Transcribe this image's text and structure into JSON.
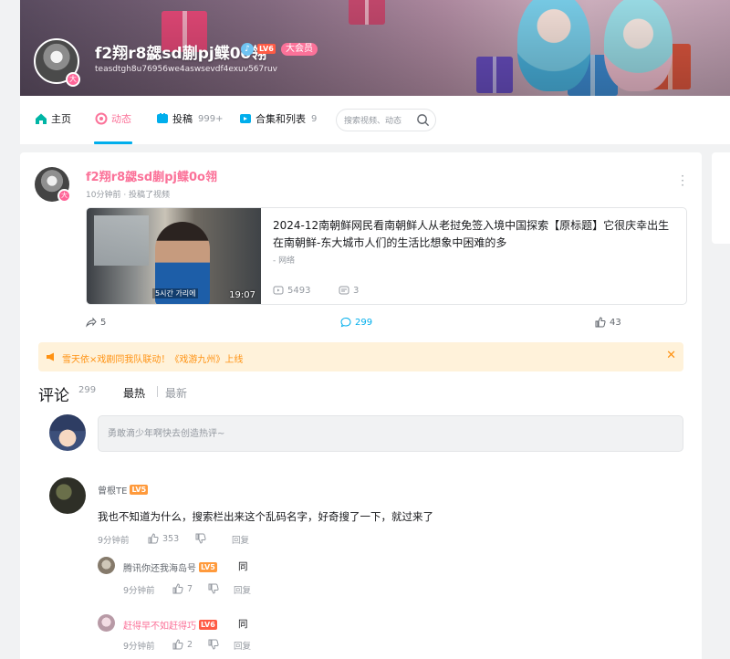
{
  "banner": {
    "username": "f2翔r8勰sd蒯pj鲽0o翎",
    "signature": "teasdtgh8u76956we4aswsevdf4exuv567ruv",
    "level": "LV6",
    "vip": "大会员",
    "avatar_badge": "大"
  },
  "nav": {
    "home": "主页",
    "dynamic": "动态",
    "submit": "投稿",
    "submit_count": "999+",
    "collection": "合集和列表",
    "collection_count": "9",
    "search_placeholder": "搜索视频、动态"
  },
  "post": {
    "author": "f2翔r8勰sd蒯pj鲽0o翎",
    "avatar_badge": "大",
    "meta": "10分钟前 · 投稿了视频",
    "video": {
      "title": "2024-12南朝鲜网民看南朝鲜人从老挝免签入境中国探索【原标题】它很庆幸出生在南朝鲜-东大城市人们的生活比想象中困难的多",
      "category": "- 网络",
      "duration": "19:07",
      "subtitle_overlay": "5시간 가리에",
      "views": "5493",
      "danmaku": "3"
    },
    "shares": "5",
    "comments": "299",
    "likes": "43"
  },
  "notice": {
    "text": "雪天依×戏剧同我队联动！《戏游九州》上线"
  },
  "comments_section": {
    "title": "评论",
    "count": "299",
    "sort_hot": "最热",
    "sort_new": "最新",
    "input_placeholder": "勇敢滴少年啊快去创造热评~"
  },
  "comment": {
    "user": "曾根TE",
    "level": "LV5",
    "text": "我也不知道为什么，搜索栏出来这个乱码名字，好奇搜了一下，就过来了",
    "time": "9分钟前",
    "likes": "353",
    "reply": "回复",
    "replies": [
      {
        "user": "腾讯你还我海岛号",
        "level": "LV5",
        "text": "同",
        "time": "9分钟前",
        "likes": "7",
        "reply": "回复"
      },
      {
        "user": "赶得早不如赶得巧",
        "level": "LV6",
        "text": "同",
        "time": "9分钟前",
        "likes": "2",
        "reply": "回复"
      }
    ]
  },
  "colors": {
    "brand_pink": "#fb7299",
    "brand_blue": "#00aeec",
    "notice_bg": "#fff2da",
    "notice_text": "#ff9212"
  }
}
